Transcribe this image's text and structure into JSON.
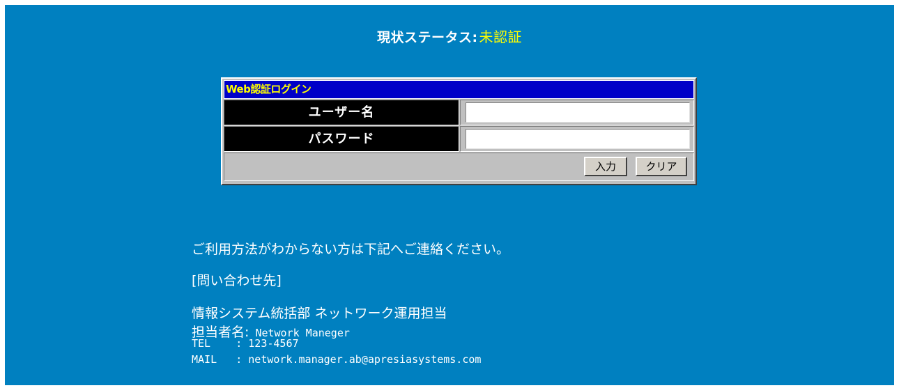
{
  "status": {
    "label": "現状ステータス:",
    "value": "未認証"
  },
  "login": {
    "title": "Web認証ログイン",
    "username_label": "ユーザー名",
    "username_value": "",
    "password_label": "パスワード",
    "password_value": "",
    "submit_label": "入力",
    "clear_label": "クリア"
  },
  "contact": {
    "guide": "ご利用方法がわからない方は下記へご連絡ください。",
    "heading": "[問い合わせ先]",
    "department": "情報システム統括部 ネットワーク運用担当",
    "person_label": "担当者名:",
    "person_value": "Network Maneger",
    "tel": "TEL    : 123-4567",
    "mail": "MAIL   : network.manager.ab@apresiasystems.com"
  },
  "colors": {
    "background": "#0080c0",
    "status_value": "#ffff00",
    "login_title_bg": "#0000c8",
    "login_title_text": "#ffff00",
    "label_bg": "#000000"
  }
}
